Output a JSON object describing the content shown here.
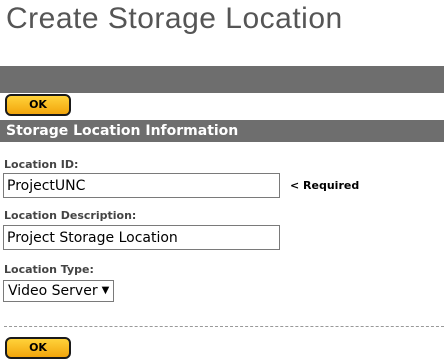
{
  "page": {
    "title": "Create Storage Location"
  },
  "toolbar": {
    "ok_label": "OK"
  },
  "section": {
    "title": "Storage Location Information"
  },
  "fields": {
    "location_id": {
      "label": "Location ID:",
      "value": "ProjectUNC",
      "required_note": "< Required"
    },
    "location_description": {
      "label": "Location Description:",
      "value": "Project Storage Location"
    },
    "location_type": {
      "label": "Location Type:",
      "selected": "Video Server",
      "arrow_icon": "dropdown-arrow-icon"
    }
  },
  "footer": {
    "ok_label": "OK"
  },
  "colors": {
    "bar": "#6e6e6e",
    "button_top": "#ffd23a",
    "button_bottom": "#f2a50c",
    "title_text": "#555555"
  }
}
